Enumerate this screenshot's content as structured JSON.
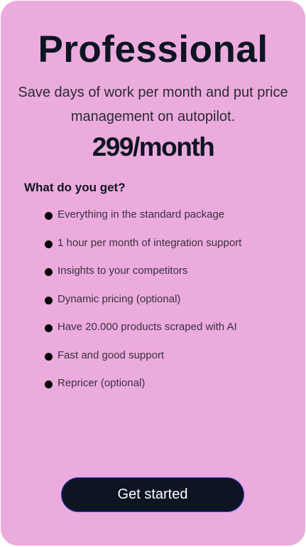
{
  "plan": {
    "title": "Professional",
    "subtitle": "Save days of work per month and put price management on autopilot.",
    "price": "299/month",
    "features_heading": "What do you get?",
    "features": [
      "Everything in the standard package",
      "1 hour per month of integration support",
      "Insights to your competitors",
      "Dynamic pricing (optional)",
      "Have 20.000 products scraped with AI",
      "Fast and good support",
      "Repricer (optional)"
    ],
    "cta_label": "Get started"
  },
  "colors": {
    "card_bg": "#ecabdd",
    "text": "#0d1523",
    "button_bg": "#0d1523"
  }
}
